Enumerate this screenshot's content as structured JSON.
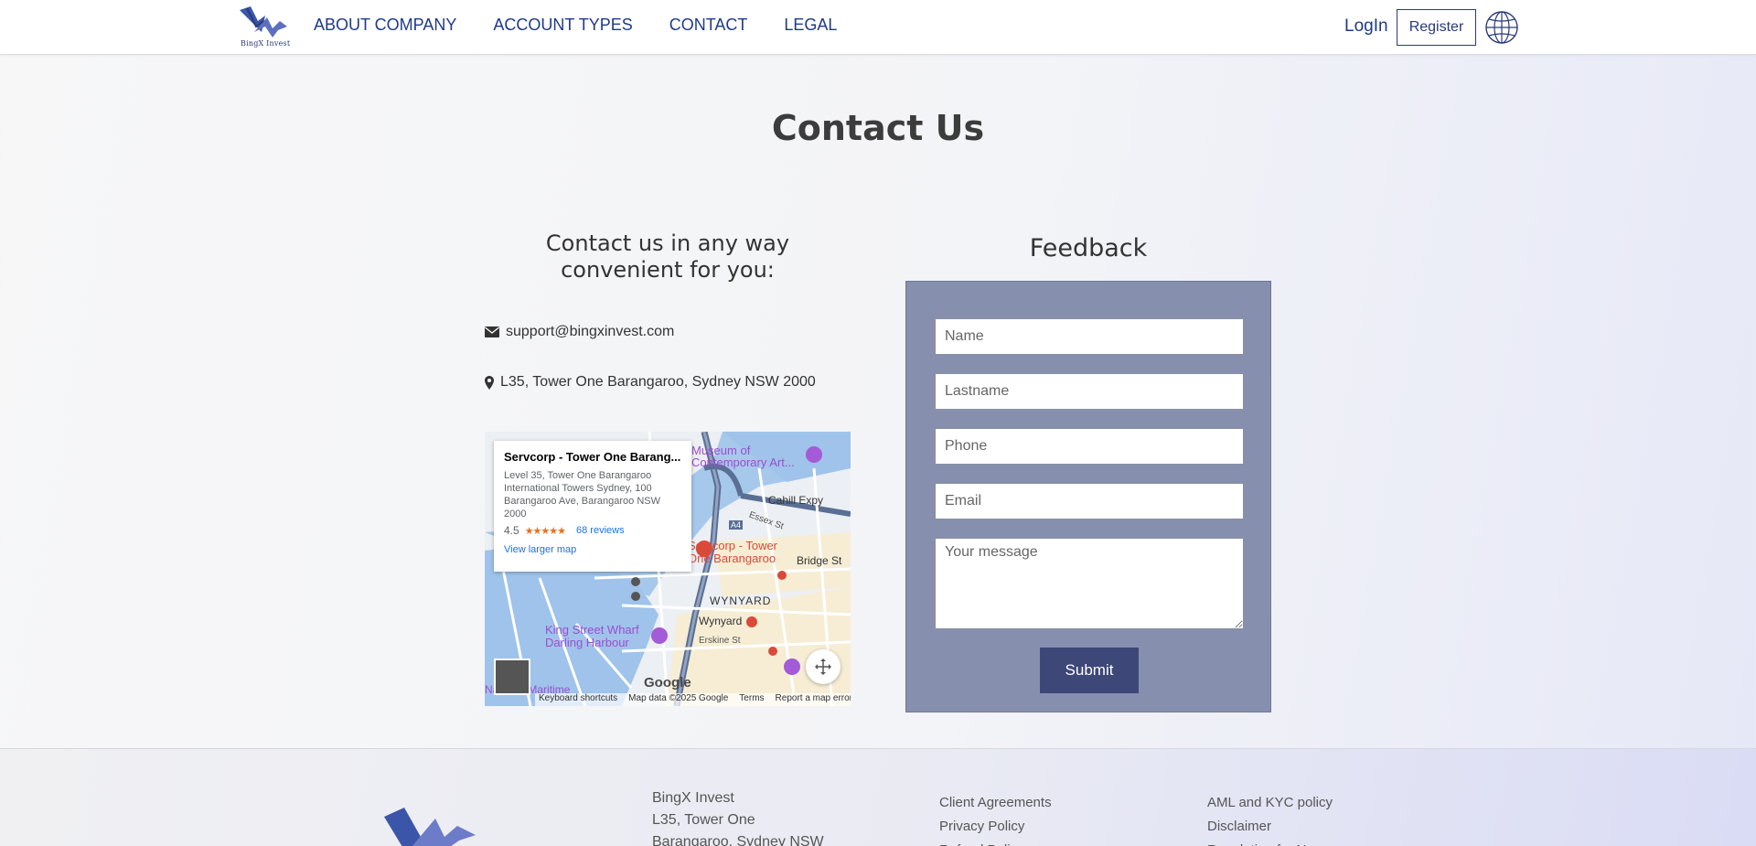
{
  "header": {
    "logo_text": "BingX Invest",
    "nav": [
      "ABOUT COMPANY",
      "ACCOUNT TYPES",
      "CONTACT",
      "LEGAL"
    ],
    "login_label": "LogIn",
    "register_label": "Register",
    "language_icon": "globe-icon",
    "brand_color": "#1f3a8a"
  },
  "main": {
    "title": "Contact Us",
    "contact_heading": "Contact us in any way convenient for you:",
    "email": "support@bingxinvest.com",
    "address": "L35, Tower One Barangaroo, Sydney NSW 2000"
  },
  "map": {
    "place_name": "Servcorp - Tower One Barang...",
    "place_address": "Level 35, Tower One Barangaroo International Towers Sydney, 100 Barangaroo Ave, Barangaroo NSW 2000",
    "rating": "4.5",
    "stars": "★★★★★",
    "reviews": "68 reviews",
    "view_larger": "View larger map",
    "labels": {
      "museum": "Museum of Contemporary Art...",
      "cahill": "Cahill Expy",
      "essex": "Essex St",
      "a4": "A4",
      "servcorp": "Servcorp - Tower One Barangaroo",
      "bridge": "Bridge St",
      "wynyard_area": "WYNYARD",
      "wynyard_station": "Wynyard",
      "king_street": "King Street Wharf Darling Harbour",
      "erskine": "Erskine St",
      "national": "National Maritime"
    },
    "google": "Google",
    "footer": [
      "Keyboard shortcuts",
      "Map data ©2025 Google",
      "Terms",
      "Report a map error"
    ]
  },
  "feedback": {
    "heading": "Feedback",
    "name_placeholder": "Name",
    "lastname_placeholder": "Lastname",
    "phone_placeholder": "Phone",
    "email_placeholder": "Email",
    "message_placeholder": "Your message",
    "submit_label": "Submit",
    "panel_color": "#8690ae",
    "button_color": "#3d4778"
  },
  "footer": {
    "address_lines": [
      "BingX Invest",
      "L35, Tower One",
      "Barangaroo, Sydney NSW"
    ],
    "col1": [
      "Client Agreements",
      "Privacy Policy",
      "Refund Policy"
    ],
    "col2": [
      "AML and KYC policy",
      "Disclaimer",
      "Regulation for N..."
    ]
  }
}
